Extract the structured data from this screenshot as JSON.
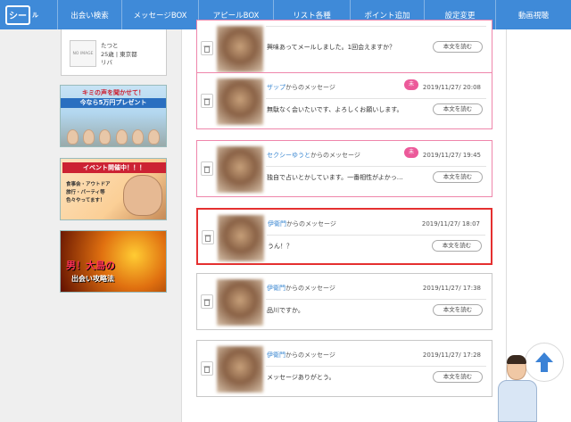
{
  "nav": {
    "logo": "シー",
    "logo_sub": "ル",
    "items": [
      "出会い検索",
      "メッセージBOX",
      "アピールBOX",
      "リスト各種",
      "ポイント追加",
      "設定変更",
      "動画視聴"
    ]
  },
  "profile": {
    "no_image": "NO IMAGE",
    "name": "たつと",
    "info": "25歳 | 東京都",
    "city": "リバ"
  },
  "banners": {
    "b1": {
      "line1": "キミの声を聞かせて！",
      "line2": "今なら5万円プレゼント"
    },
    "b2": {
      "title": "イベント開催中！！！",
      "sub1": "食事会・アウトドア",
      "sub2": "旅行・パーティ等",
      "sub3": "色々やってます！"
    },
    "b3": {
      "title": "男！大島の",
      "sub": "出会い攻略法"
    }
  },
  "common": {
    "from_suffix": "からのメッセージ",
    "read_button": "本文を読む",
    "unread_badge": "未"
  },
  "messages": [
    {
      "sender": "",
      "date": "",
      "snippet": "興味あってメールしました。1回会えますか？",
      "unread": true
    },
    {
      "sender": "ザップ",
      "date": "2019/11/27/ 20:08",
      "snippet": "無駄なく会いたいです、よろしくお願いします。",
      "unread": true
    },
    {
      "sender": "セクシーゆうと",
      "date": "2019/11/27/ 19:45",
      "snippet": "独自で占いとかしています。一番相性がよかっ…",
      "unread": true
    },
    {
      "sender": "伊衛門",
      "date": "2019/11/27/ 18:07",
      "snippet": "うん！？",
      "unread": false,
      "selected": true
    },
    {
      "sender": "伊衛門",
      "date": "2019/11/27/ 17:38",
      "snippet": "品川ですか。",
      "unread": false
    },
    {
      "sender": "伊衛門",
      "date": "2019/11/27/ 17:28",
      "snippet": "メッセージありがとう。",
      "unread": false
    }
  ],
  "colors": {
    "nav": "#3f8ad8",
    "unread_border": "#ef86ab",
    "selected_border": "#e53030",
    "sender_link": "#3a87d1",
    "badge": "#ec5a9a",
    "scroll_top_arrow": "#3b82d6"
  },
  "icons": {
    "trash": "trash-icon",
    "scroll_top": "arrow-up-icon"
  }
}
